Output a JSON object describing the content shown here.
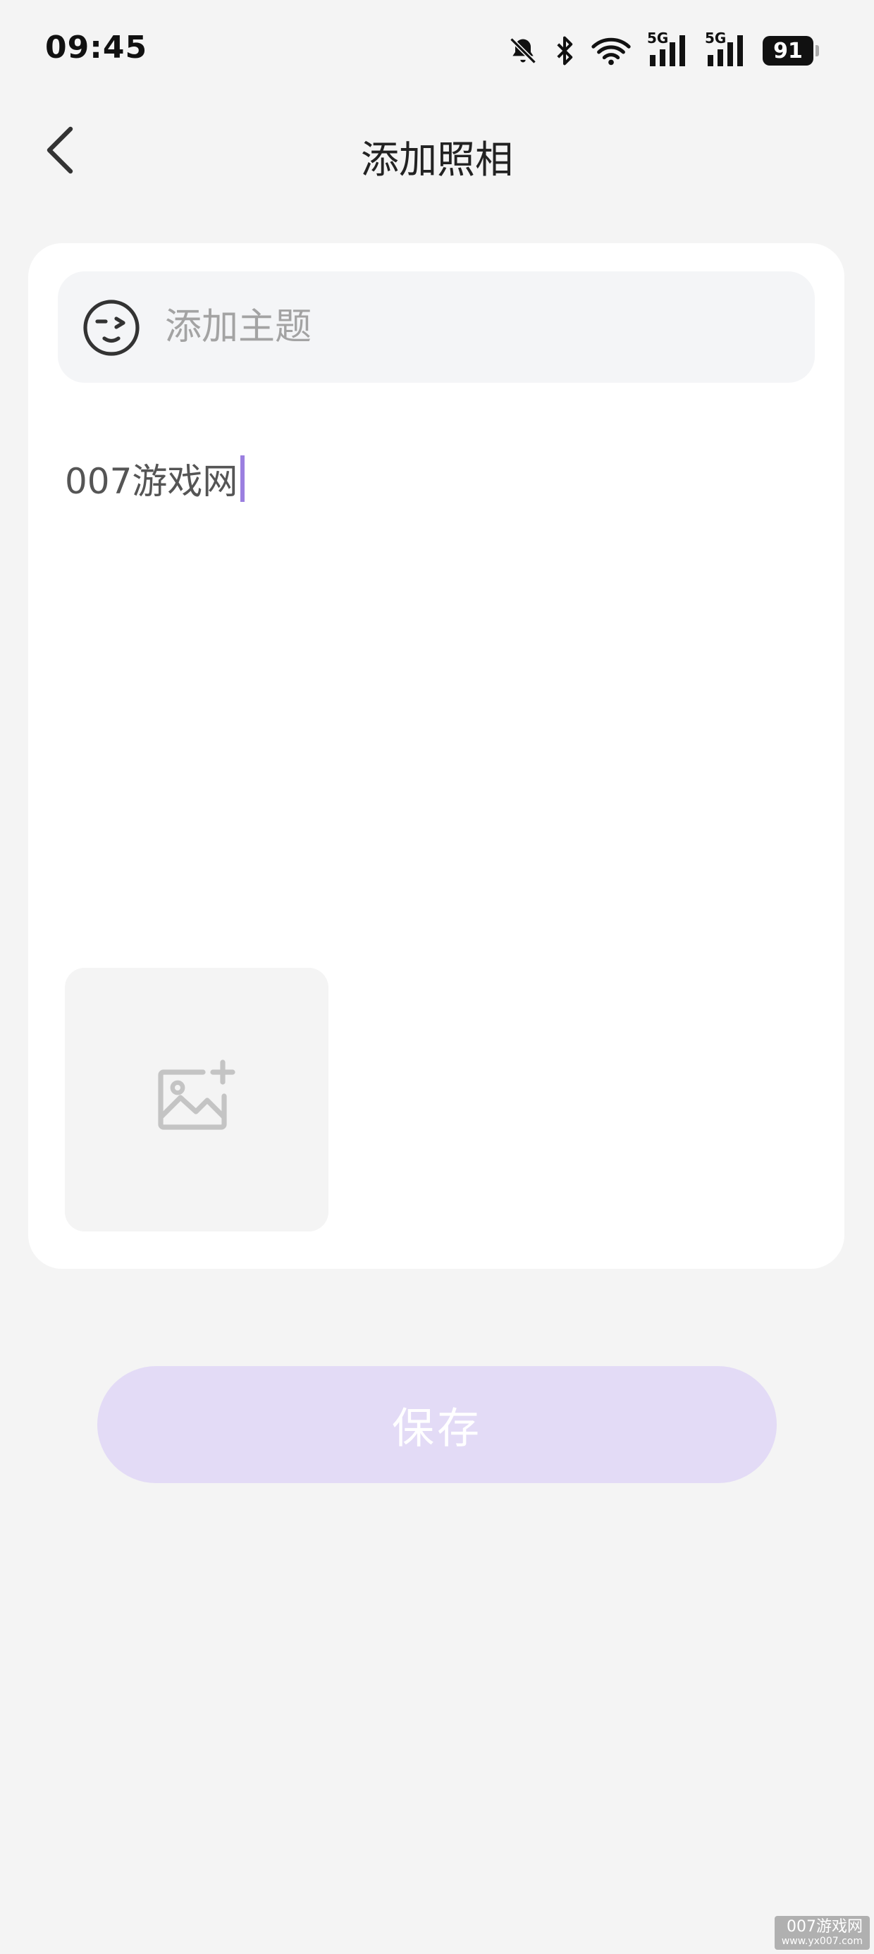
{
  "status_bar": {
    "time": "09:45",
    "battery": "91",
    "network_1": "5G",
    "network_2": "5G"
  },
  "nav": {
    "title": "添加照相"
  },
  "form": {
    "topic_placeholder": "添加主题",
    "content_text": "007游戏网"
  },
  "actions": {
    "save_label": "保存"
  },
  "watermark": {
    "main": "007游戏网",
    "sub": "www.yx007.com"
  },
  "colors": {
    "accent": "#9b7fe0",
    "save_button_bg": "#e3dbf6",
    "page_bg": "#f4f4f4",
    "card_bg": "#ffffff"
  },
  "icons": {
    "back": "chevron-left-icon",
    "topic": "wink-face-icon",
    "add_image": "add-image-icon",
    "mute": "bell-off-icon",
    "bluetooth": "bluetooth-icon",
    "wifi": "wifi-icon",
    "signal": "signal-icon"
  }
}
